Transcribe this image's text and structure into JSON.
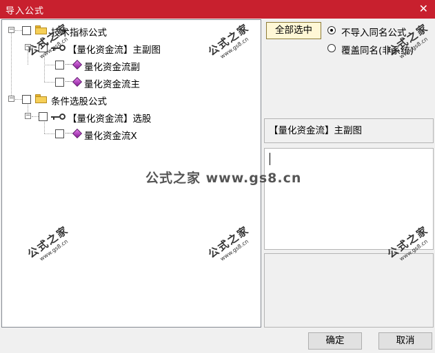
{
  "window": {
    "title": "导入公式",
    "close_glyph": "✕"
  },
  "tree": {
    "groups": [
      {
        "label": "技术指标公式",
        "children": [
          {
            "label": "【量化资金流】主副图",
            "children": [
              {
                "label": "量化资金流副"
              },
              {
                "label": "量化资金流主"
              }
            ]
          }
        ]
      },
      {
        "label": "条件选股公式",
        "children": [
          {
            "label": "【量化资金流】选股",
            "children": [
              {
                "label": "量化资金流X"
              }
            ]
          }
        ]
      }
    ]
  },
  "controls": {
    "select_all": "全部选中",
    "radio_skip": "不导入同名公式",
    "radio_overwrite": "覆盖同名(非系统)",
    "selected_option": "skip"
  },
  "detail": {
    "name": "【量化资金流】主副图",
    "description": ""
  },
  "buttons": {
    "ok": "确定",
    "cancel": "取消"
  },
  "watermark": {
    "cn": "公式之家",
    "url": "www.gs8.cn",
    "center": "公式之家 www.gs8.cn"
  },
  "icons": {
    "folder": "folder-icon",
    "formula_set": "key-icon",
    "formula": "gem-icon"
  }
}
